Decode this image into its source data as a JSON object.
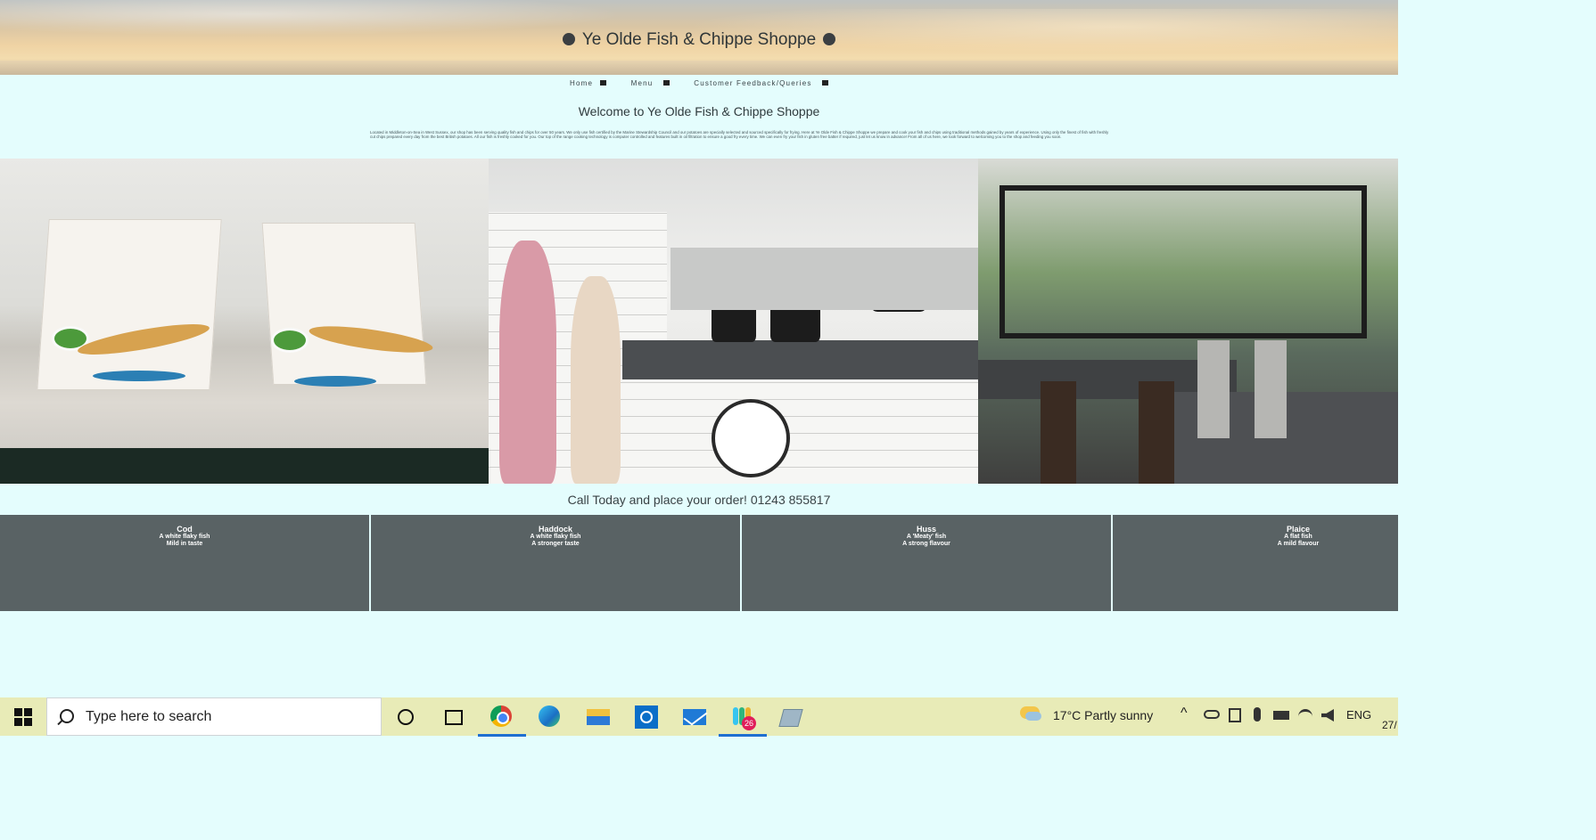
{
  "site": {
    "title": "Ye Olde Fish & Chippe Shoppe",
    "nav": [
      "Home",
      "Menu",
      "Customer Feedback/Queries"
    ],
    "welcome": "Welcome to Ye Olde Fish & Chippe Shoppe",
    "intro": "Located in Middleton-on-Sea in West Sussex, our shop has been serving quality fish and chips for over 50 years. We only use fish certified by the Marine Stewardship Council and our potatoes are specially selected and sourced specifically for frying. Here at Ye Olde Fish & Chippe Shoppe we prepare and cook your fish and chips using traditional methods gained by years of experience. Using only the finest of fish with freshly cut chips prepared every day from the best British potatoes. All our fish is freshly cooked for you. Our top of the range cooking technology is computer controlled and features built in oil filtration to ensure a good fry every time. We can even fry your fish in gluten free batter if required, just let us know in advance! From all of us here, we look forward to welcoming you to the shop and feeding you soon.",
    "callout": "Call Today and place your order! 01243 855817",
    "photos": [
      "fish-and-chips-boxes-photo",
      "shop-counter-photo",
      "seating-area-photo"
    ],
    "fish": [
      {
        "name": "Cod",
        "line1": "A white flaky fish",
        "line2": "Mild in taste"
      },
      {
        "name": "Haddock",
        "line1": "A white flaky fish",
        "line2": "A stronger taste"
      },
      {
        "name": "Huss",
        "line1": "A 'Meaty' fish",
        "line2": "A strong flavour"
      },
      {
        "name": "Plaice",
        "line1": "A flat fish",
        "line2": "A mild flavour"
      }
    ]
  },
  "taskbar": {
    "search_placeholder": "Type here to search",
    "weather": "17°C  Partly sunny",
    "lang": "ENG",
    "date_partial": "27/",
    "badge": "26",
    "apps": [
      "cortana-icon",
      "task-view-icon",
      "chrome-icon",
      "edge-icon",
      "file-explorer-icon",
      "dell-icon",
      "mail-icon",
      "slack-icon",
      "notes-icon"
    ]
  },
  "colors": {
    "page_bg": "#e4fdfd",
    "card_bg": "#596264",
    "taskbar_bg": "#e8ebb7",
    "accent": "#1f6fd1"
  }
}
